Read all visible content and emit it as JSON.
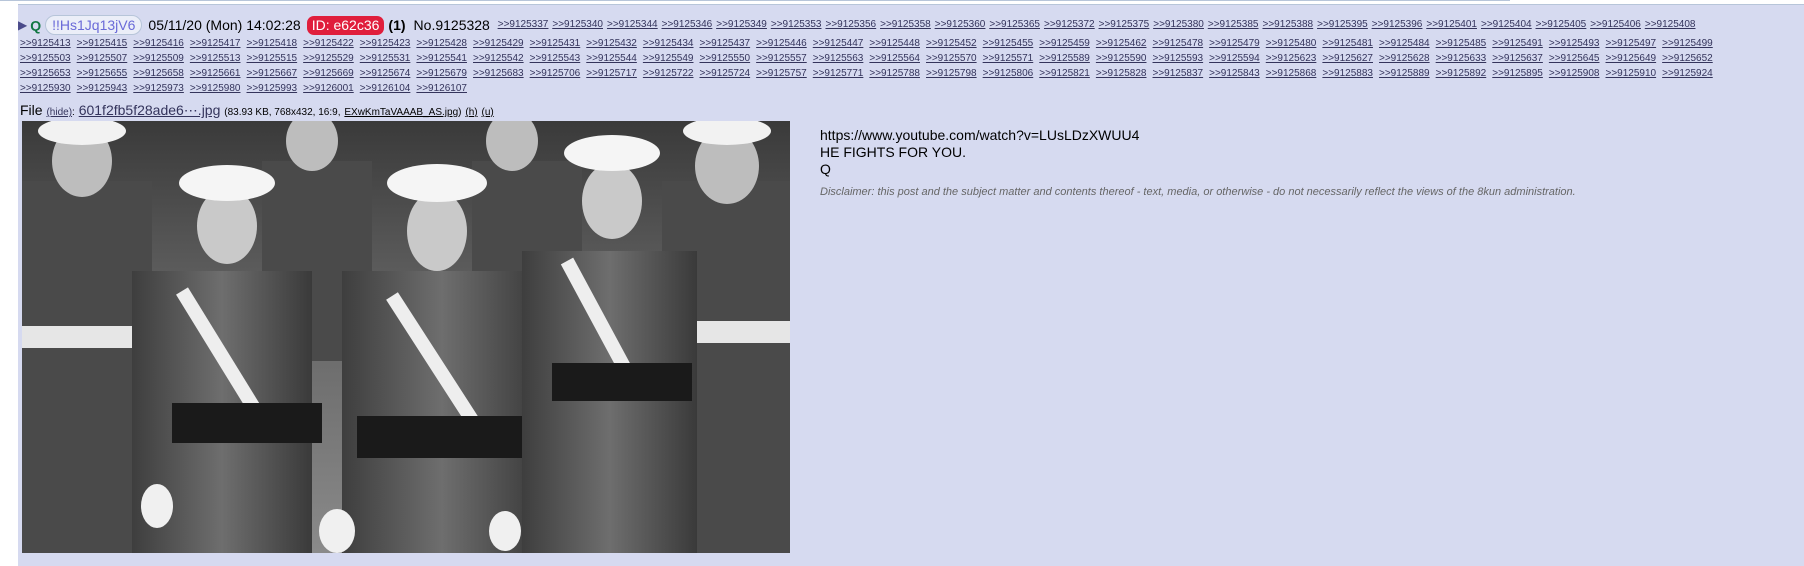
{
  "post": {
    "arrow": "▶",
    "name": "Q",
    "tripcode": "!!Hs1Jq13jV6",
    "datetime": "05/11/20 (Mon) 14:02:28",
    "id_label": "ID: e62c36",
    "id_color": "#e01e3c",
    "post_count": "(1)",
    "post_number": "No.9125328",
    "replies_line1": [
      ">>9125337",
      ">>9125340",
      ">>9125344",
      ">>9125346",
      ">>9125349",
      ">>9125353",
      ">>9125356",
      ">>9125358",
      ">>9125360",
      ">>9125365",
      ">>9125372",
      ">>9125375",
      ">>9125380",
      ">>9125385",
      ">>9125388",
      ">>9125395",
      ">>9125396",
      ">>9125401",
      ">>9125404",
      ">>9125405",
      ">>9125406",
      ">>9125408"
    ],
    "replies_line2": [
      ">>9125413",
      ">>9125415",
      ">>9125416",
      ">>9125417",
      ">>9125418",
      ">>9125422",
      ">>9125423",
      ">>9125428",
      ">>9125429",
      ">>9125431",
      ">>9125432",
      ">>9125434",
      ">>9125437",
      ">>9125446",
      ">>9125447",
      ">>9125448",
      ">>9125452",
      ">>9125455",
      ">>9125459",
      ">>9125462",
      ">>9125478",
      ">>9125479",
      ">>9125480",
      ">>9125481",
      ">>9125484",
      ">>9125485",
      ">>9125491",
      ">>9125493",
      ">>9125497",
      ">>9125499"
    ],
    "replies_line3": [
      ">>9125503",
      ">>9125507",
      ">>9125509",
      ">>9125513",
      ">>9125515",
      ">>9125529",
      ">>9125531",
      ">>9125541",
      ">>9125542",
      ">>9125543",
      ">>9125544",
      ">>9125549",
      ">>9125550",
      ">>9125557",
      ">>9125563",
      ">>9125564",
      ">>9125570",
      ">>9125571",
      ">>9125589",
      ">>9125590",
      ">>9125593",
      ">>9125594",
      ">>9125623",
      ">>9125627",
      ">>9125628",
      ">>9125633",
      ">>9125637",
      ">>9125645",
      ">>9125649",
      ">>9125652"
    ],
    "replies_line4": [
      ">>9125653",
      ">>9125655",
      ">>9125658",
      ">>9125661",
      ">>9125667",
      ">>9125669",
      ">>9125674",
      ">>9125679",
      ">>9125683",
      ">>9125706",
      ">>9125717",
      ">>9125722",
      ">>9125724",
      ">>9125757",
      ">>9125771",
      ">>9125788",
      ">>9125798",
      ">>9125806",
      ">>9125821",
      ">>9125828",
      ">>9125837",
      ">>9125843",
      ">>9125868",
      ">>9125883",
      ">>9125889",
      ">>9125892",
      ">>9125895",
      ">>9125908",
      ">>9125910",
      ">>9125924"
    ],
    "replies_line5": [
      ">>9125930",
      ">>9125943",
      ">>9125973",
      ">>9125980",
      ">>9125993",
      ">>9126001",
      ">>9126104",
      ">>9126107"
    ],
    "file": {
      "label": "File",
      "hide": "(hide)",
      "filename": "601f2fb5f28ade6⋯.jpg",
      "meta": "(83.93 KB, 768x432, 16:9,",
      "original_name": "EXwKmTaVAAAB_AS.jpg",
      "meta_close": ")",
      "b_link": "(h)",
      "u_link": "(u)"
    },
    "body": {
      "line1": "https://www.youtube.com/watch?v=LUsLDzXWUU4",
      "line2": "HE FIGHTS FOR YOU.",
      "line3": "Q",
      "disclaimer": "Disclaimer: this post and the subject matter and contents thereof - text, media, or otherwise - do not necessarily reflect the views of the 8kun administration."
    }
  }
}
